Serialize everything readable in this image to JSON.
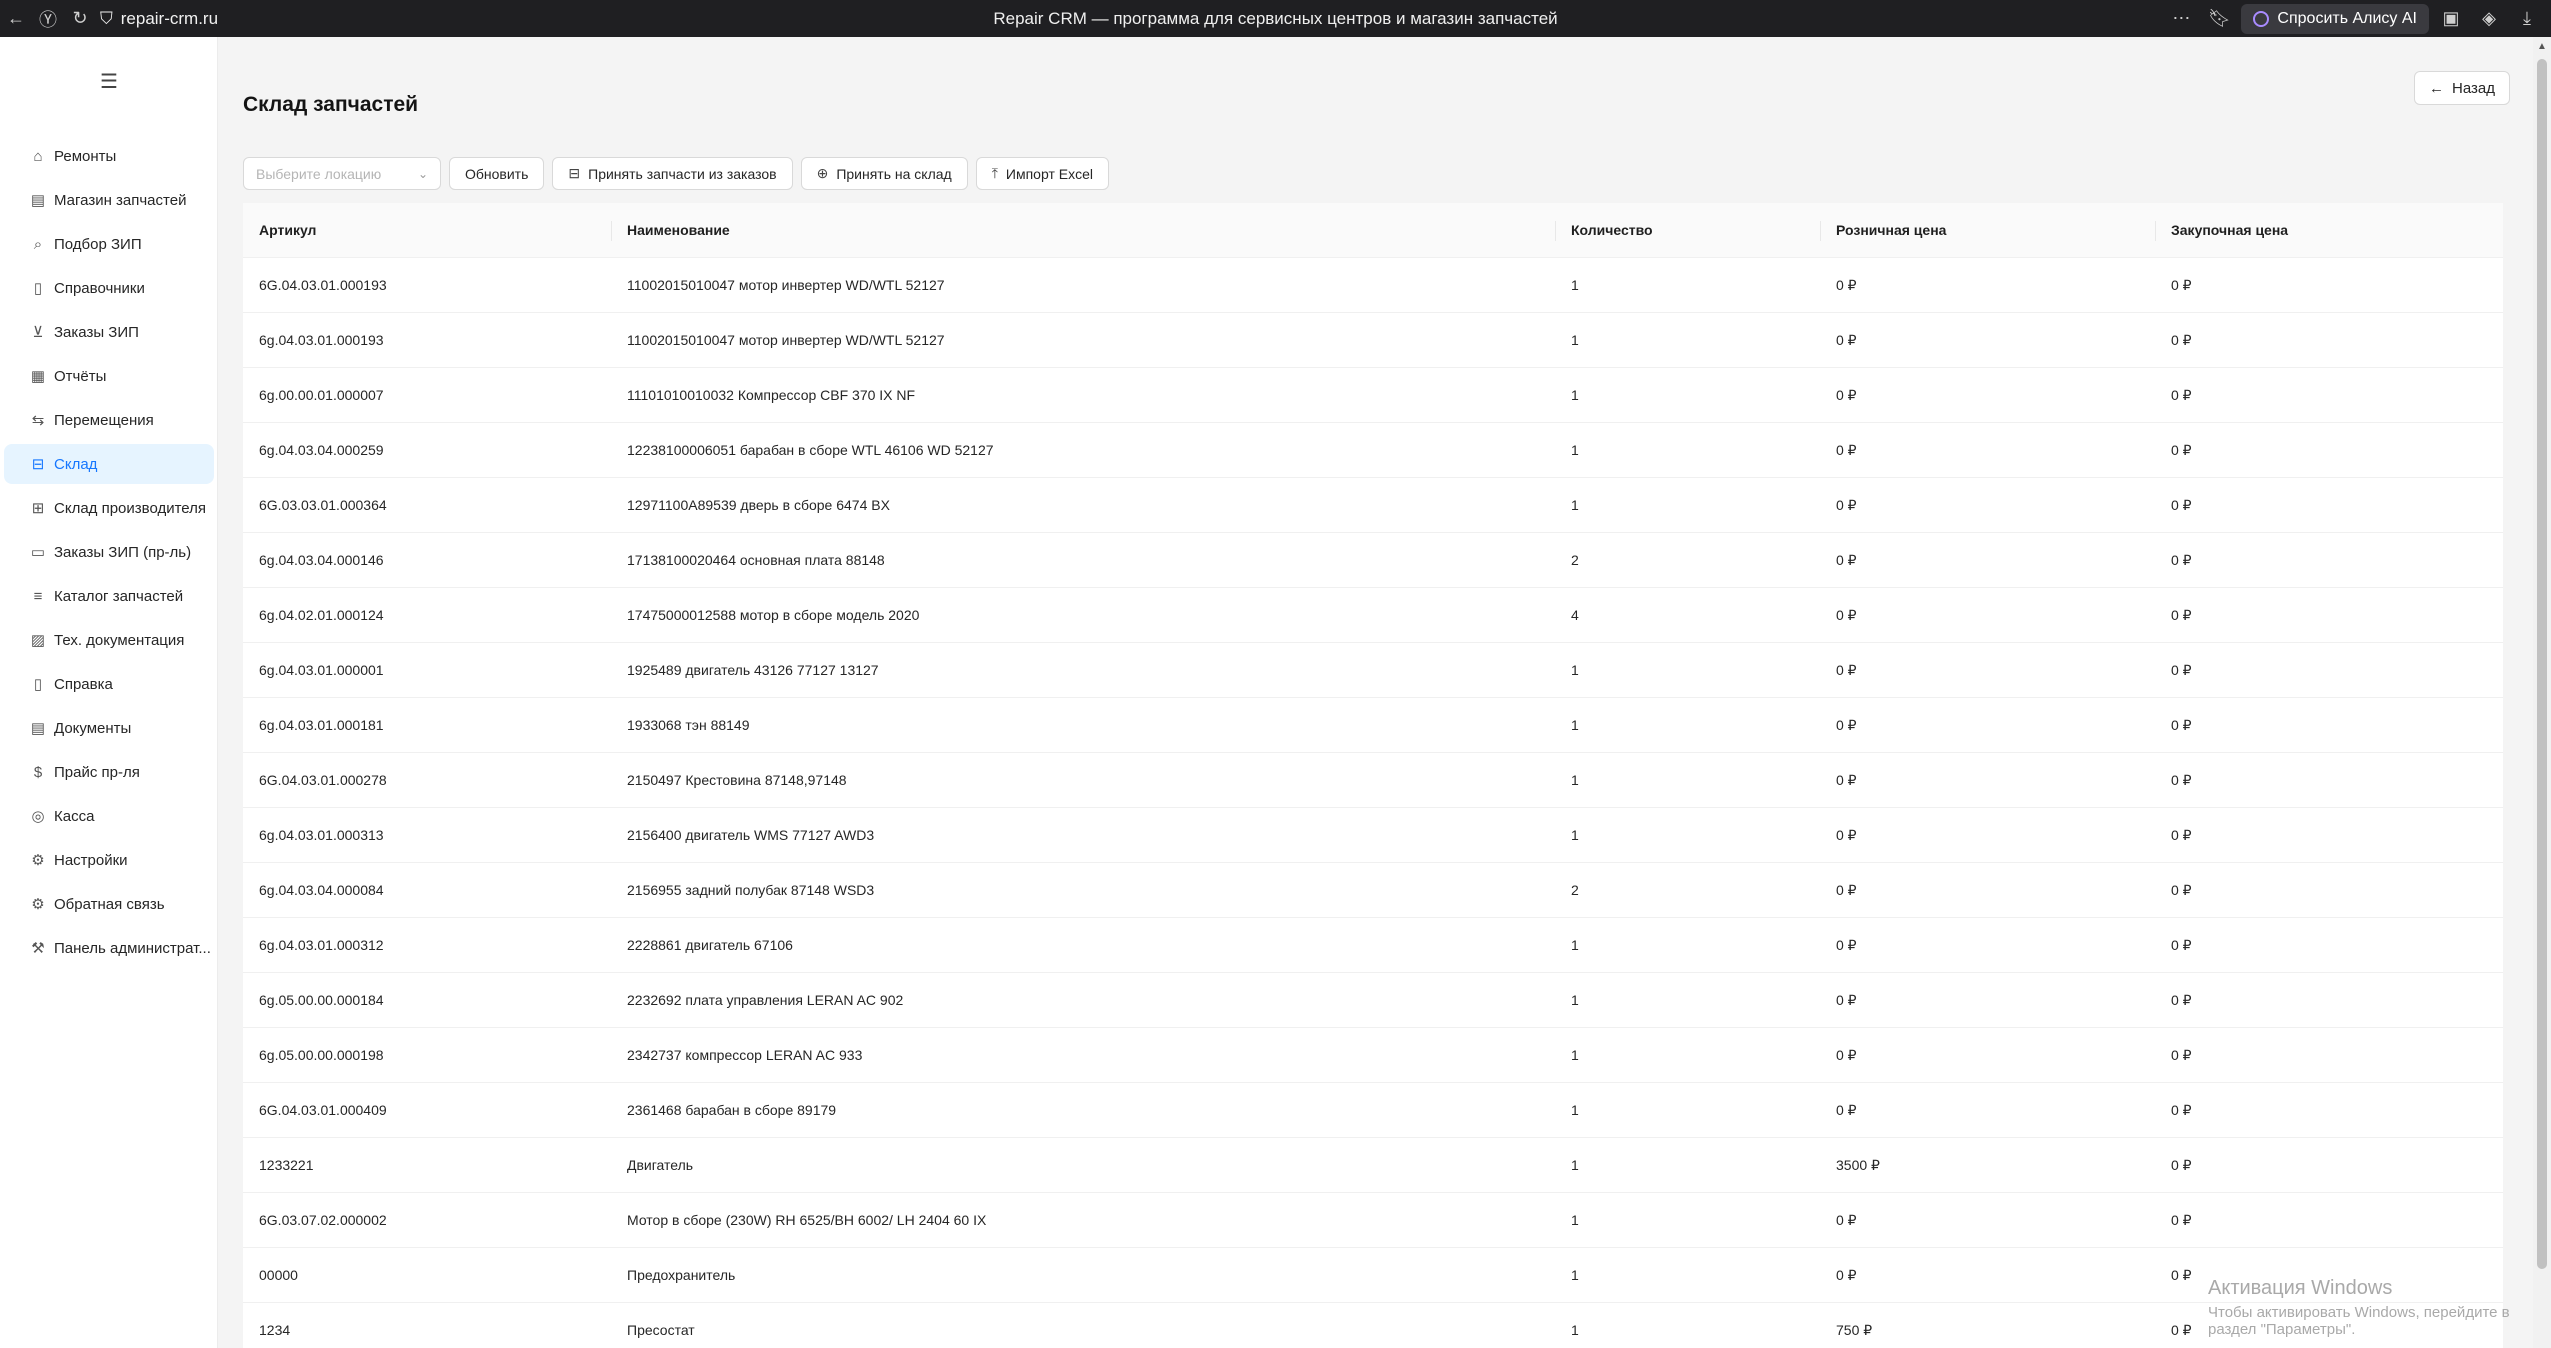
{
  "browser": {
    "url": "repair-crm.ru",
    "title": "Repair CRM — программа для сервисных центров и магазин запчастей",
    "alice_label": "Спросить Алису AI"
  },
  "sidebar": {
    "items": [
      {
        "label": "Ремонты",
        "icon": "home-icon"
      },
      {
        "label": "Магазин запчастей",
        "icon": "store-icon"
      },
      {
        "label": "Подбор ЗИП",
        "icon": "search-icon"
      },
      {
        "label": "Справочники",
        "icon": "book-icon"
      },
      {
        "label": "Заказы ЗИП",
        "icon": "cart-icon"
      },
      {
        "label": "Отчёты",
        "icon": "report-icon"
      },
      {
        "label": "Перемещения",
        "icon": "swap-icon"
      },
      {
        "label": "Склад",
        "icon": "box-icon",
        "active": true
      },
      {
        "label": "Склад производителя",
        "icon": "warehouse-icon"
      },
      {
        "label": "Заказы ЗИП (пр-ль)",
        "icon": "doc-icon"
      },
      {
        "label": "Каталог запчастей",
        "icon": "list-icon"
      },
      {
        "label": "Тех. документация",
        "icon": "tech-doc-icon"
      },
      {
        "label": "Справка",
        "icon": "help-icon"
      },
      {
        "label": "Документы",
        "icon": "documents-icon"
      },
      {
        "label": "Прайс пр-ля",
        "icon": "price-icon"
      },
      {
        "label": "Касса",
        "icon": "cash-icon"
      },
      {
        "label": "Настройки",
        "icon": "gear-icon"
      },
      {
        "label": "Обратная связь",
        "icon": "feedback-icon"
      },
      {
        "label": "Панель администрат...",
        "icon": "admin-icon"
      }
    ]
  },
  "page": {
    "title": "Склад запчастей",
    "back_label": "Назад"
  },
  "toolbar": {
    "location_placeholder": "Выберите локацию",
    "refresh_label": "Обновить",
    "accept_orders_label": "Принять запчасти из заказов",
    "accept_stock_label": "Принять на склад",
    "import_excel_label": "Импорт Excel"
  },
  "table": {
    "columns": [
      "Артикул",
      "Наименование",
      "Количество",
      "Розничная цена",
      "Закупочная цена"
    ],
    "rows": [
      [
        "6G.04.03.01.000193",
        "11002015010047 мотор инвертер WD/WTL 52127",
        "1",
        "0 ₽",
        "0 ₽"
      ],
      [
        "6g.04.03.01.000193",
        "11002015010047 мотор инвертер WD/WTL 52127",
        "1",
        "0 ₽",
        "0 ₽"
      ],
      [
        "6g.00.00.01.000007",
        "11101010010032 Компрессор CBF 370 IX NF",
        "1",
        "0 ₽",
        "0 ₽"
      ],
      [
        "6g.04.03.04.000259",
        "12238100006051 барабан в сборе WTL 46106 WD 52127",
        "1",
        "0 ₽",
        "0 ₽"
      ],
      [
        "6G.03.03.01.000364",
        "12971100A89539 дверь в сборе 6474 BX",
        "1",
        "0 ₽",
        "0 ₽"
      ],
      [
        "6g.04.03.04.000146",
        "17138100020464 основная плата 88148",
        "2",
        "0 ₽",
        "0 ₽"
      ],
      [
        "6g.04.02.01.000124",
        "17475000012588 мотор в сборе модель 2020",
        "4",
        "0 ₽",
        "0 ₽"
      ],
      [
        "6g.04.03.01.000001",
        "1925489 двигатель 43126 77127 13127",
        "1",
        "0 ₽",
        "0 ₽"
      ],
      [
        "6g.04.03.01.000181",
        "1933068 тэн 88149",
        "1",
        "0 ₽",
        "0 ₽"
      ],
      [
        "6G.04.03.01.000278",
        "2150497 Крестовина 87148,97148",
        "1",
        "0 ₽",
        "0 ₽"
      ],
      [
        "6g.04.03.01.000313",
        "2156400 двигатель WMS 77127 AWD3",
        "1",
        "0 ₽",
        "0 ₽"
      ],
      [
        "6g.04.03.04.000084",
        "2156955 задний полубак 87148 WSD3",
        "2",
        "0 ₽",
        "0 ₽"
      ],
      [
        "6g.04.03.01.000312",
        "2228861 двигатель 67106",
        "1",
        "0 ₽",
        "0 ₽"
      ],
      [
        "6g.05.00.00.000184",
        "2232692 плата управления LERAN AC 902",
        "1",
        "0 ₽",
        "0 ₽"
      ],
      [
        "6g.05.00.00.000198",
        "2342737 компрессор LERAN AC 933",
        "1",
        "0 ₽",
        "0 ₽"
      ],
      [
        "6G.04.03.01.000409",
        "2361468 барабан в сборе 89179",
        "1",
        "0 ₽",
        "0 ₽"
      ],
      [
        "1233221",
        "Двигатель",
        "1",
        "3500 ₽",
        "0 ₽"
      ],
      [
        "6G.03.07.02.000002",
        "Мотор в сборе (230W) RH 6525/BH 6002/ LH 2404 60 IX",
        "1",
        "0 ₽",
        "0 ₽"
      ],
      [
        "00000",
        "Предохранитель",
        "1",
        "0 ₽",
        "0 ₽"
      ],
      [
        "1234",
        "Пресостат",
        "1",
        "750 ₽",
        "0 ₽"
      ]
    ]
  },
  "watermark": {
    "line1": "Активация Windows",
    "line2": "Чтобы активировать Windows, перейдите в раздел \"Параметры\"."
  }
}
